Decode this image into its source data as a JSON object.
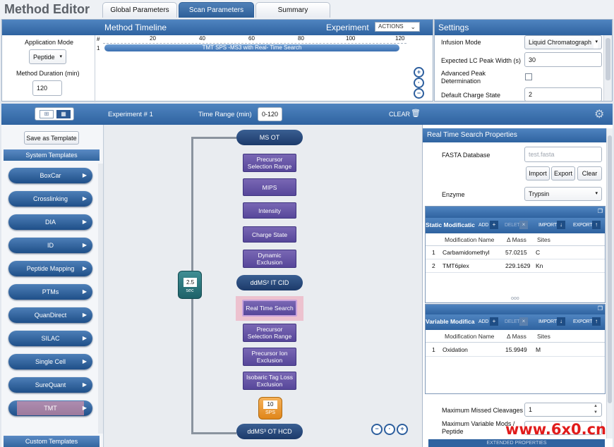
{
  "app": {
    "title": "Method Editor"
  },
  "tabs": [
    {
      "label": "Global Parameters",
      "active": false
    },
    {
      "label": "Scan Parameters",
      "active": true
    },
    {
      "label": "Summary",
      "active": false
    }
  ],
  "timeline": {
    "header": "Method Timeline",
    "experiment_label": "Experiment",
    "actions_label": "ACTIONS",
    "row_header": "#",
    "ticks": [
      "20",
      "40",
      "60",
      "80",
      "100",
      "120"
    ],
    "row_number": "1",
    "bar_label": "TMT SPS -MS3 with Real- Time Search",
    "application_mode_label": "Application Mode",
    "application_mode_value": "Peptide",
    "method_duration_label": "Method Duration (min)",
    "method_duration_value": "120"
  },
  "settings": {
    "header": "Settings",
    "rows": [
      {
        "label": "Infusion Mode",
        "value": "Liquid Chromatograph"
      },
      {
        "label": "Expected LC Peak Width (s)",
        "value": "30"
      },
      {
        "label": "Advanced Peak Determination",
        "value": ""
      },
      {
        "label": "Default Charge State",
        "value": "2"
      }
    ]
  },
  "experiment_bar": {
    "experiment_number": "Experiment # 1",
    "time_range_label": "Time Range (min)",
    "time_range_value": "0-120",
    "clear_label": "CLEAR"
  },
  "templates": {
    "save_button": "Save as Template",
    "system_header": "System Templates",
    "items": [
      "BoxCar",
      "Crosslinking",
      "DIA",
      "ID",
      "Peptide Mapping",
      "PTMs",
      "QuanDirect",
      "SILAC",
      "Single Cell",
      "SureQuant",
      "TMT"
    ],
    "custom_header": "Custom Templates"
  },
  "workflow": {
    "ms_ot": "MS OT",
    "nodes1": [
      "Precursor Selection Range",
      "MIPS",
      "Intensity",
      "Charge State",
      "Dynamic Exclusion"
    ],
    "ddms2": "ddMS² IT CID",
    "rts": "Real Time Search",
    "nodes2": [
      "Precursor Selection Range",
      "Precursor Ion Exclusion",
      "Isobaric Tag Loss Exclusion"
    ],
    "ddms3": "ddMS³ OT HCD",
    "cycle_value": "2.5",
    "cycle_unit": "sec",
    "sps_value": "10",
    "sps_label": "SPS"
  },
  "rts_props": {
    "header": "Real Time Search Properties",
    "fasta_label": "FASTA Database",
    "fasta_placeholder": "test.fasta",
    "import_btn": "Import",
    "export_btn": "Export",
    "clear_btn": "Clear",
    "enzyme_label": "Enzyme",
    "enzyme_value": "Trypsin",
    "static_mods": {
      "title": "Static Modificatic",
      "tools": [
        "ADD",
        "DELETE",
        "IMPORT",
        "EXPORT"
      ],
      "columns": [
        "Modification Name",
        "Δ Mass",
        "Sites"
      ],
      "rows": [
        {
          "n": "1",
          "name": "Carbamidomethyl",
          "mass": "57.0215",
          "sites": "C"
        },
        {
          "n": "2",
          "name": "TMT6plex",
          "mass": "229.1629",
          "sites": "Kn"
        }
      ]
    },
    "variable_mods": {
      "title": "Variable Modifica",
      "tools": [
        "ADD",
        "DELETE",
        "IMPORT",
        "EXPORT"
      ],
      "columns": [
        "Modification Name",
        "Δ Mass",
        "Sites"
      ],
      "rows": [
        {
          "n": "1",
          "name": "Oxidation",
          "mass": "15.9949",
          "sites": "M"
        }
      ]
    },
    "max_missed_label": "Maximum Missed Cleavages",
    "max_missed_value": "1",
    "max_var_label": "Maximum Variable Mods / Peptide",
    "max_var_value": "1",
    "extended_label": "EXTENDED PROPERTIES"
  },
  "watermark": "www.6x0.cn"
}
